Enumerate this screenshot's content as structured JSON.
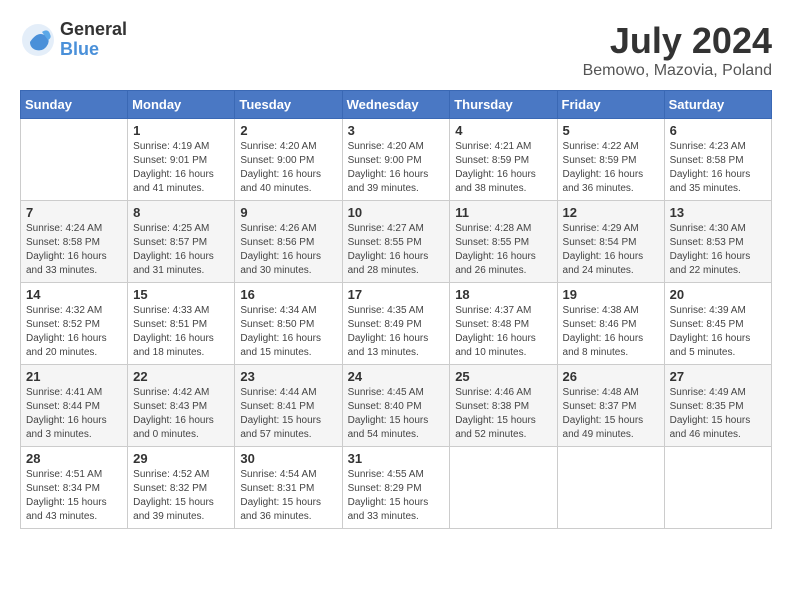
{
  "logo": {
    "general": "General",
    "blue": "Blue"
  },
  "title": {
    "month_year": "July 2024",
    "location": "Bemowo, Mazovia, Poland"
  },
  "days_of_week": [
    "Sunday",
    "Monday",
    "Tuesday",
    "Wednesday",
    "Thursday",
    "Friday",
    "Saturday"
  ],
  "weeks": [
    [
      {
        "day": "",
        "info": ""
      },
      {
        "day": "1",
        "info": "Sunrise: 4:19 AM\nSunset: 9:01 PM\nDaylight: 16 hours\nand 41 minutes."
      },
      {
        "day": "2",
        "info": "Sunrise: 4:20 AM\nSunset: 9:00 PM\nDaylight: 16 hours\nand 40 minutes."
      },
      {
        "day": "3",
        "info": "Sunrise: 4:20 AM\nSunset: 9:00 PM\nDaylight: 16 hours\nand 39 minutes."
      },
      {
        "day": "4",
        "info": "Sunrise: 4:21 AM\nSunset: 8:59 PM\nDaylight: 16 hours\nand 38 minutes."
      },
      {
        "day": "5",
        "info": "Sunrise: 4:22 AM\nSunset: 8:59 PM\nDaylight: 16 hours\nand 36 minutes."
      },
      {
        "day": "6",
        "info": "Sunrise: 4:23 AM\nSunset: 8:58 PM\nDaylight: 16 hours\nand 35 minutes."
      }
    ],
    [
      {
        "day": "7",
        "info": "Sunrise: 4:24 AM\nSunset: 8:58 PM\nDaylight: 16 hours\nand 33 minutes."
      },
      {
        "day": "8",
        "info": "Sunrise: 4:25 AM\nSunset: 8:57 PM\nDaylight: 16 hours\nand 31 minutes."
      },
      {
        "day": "9",
        "info": "Sunrise: 4:26 AM\nSunset: 8:56 PM\nDaylight: 16 hours\nand 30 minutes."
      },
      {
        "day": "10",
        "info": "Sunrise: 4:27 AM\nSunset: 8:55 PM\nDaylight: 16 hours\nand 28 minutes."
      },
      {
        "day": "11",
        "info": "Sunrise: 4:28 AM\nSunset: 8:55 PM\nDaylight: 16 hours\nand 26 minutes."
      },
      {
        "day": "12",
        "info": "Sunrise: 4:29 AM\nSunset: 8:54 PM\nDaylight: 16 hours\nand 24 minutes."
      },
      {
        "day": "13",
        "info": "Sunrise: 4:30 AM\nSunset: 8:53 PM\nDaylight: 16 hours\nand 22 minutes."
      }
    ],
    [
      {
        "day": "14",
        "info": "Sunrise: 4:32 AM\nSunset: 8:52 PM\nDaylight: 16 hours\nand 20 minutes."
      },
      {
        "day": "15",
        "info": "Sunrise: 4:33 AM\nSunset: 8:51 PM\nDaylight: 16 hours\nand 18 minutes."
      },
      {
        "day": "16",
        "info": "Sunrise: 4:34 AM\nSunset: 8:50 PM\nDaylight: 16 hours\nand 15 minutes."
      },
      {
        "day": "17",
        "info": "Sunrise: 4:35 AM\nSunset: 8:49 PM\nDaylight: 16 hours\nand 13 minutes."
      },
      {
        "day": "18",
        "info": "Sunrise: 4:37 AM\nSunset: 8:48 PM\nDaylight: 16 hours\nand 10 minutes."
      },
      {
        "day": "19",
        "info": "Sunrise: 4:38 AM\nSunset: 8:46 PM\nDaylight: 16 hours\nand 8 minutes."
      },
      {
        "day": "20",
        "info": "Sunrise: 4:39 AM\nSunset: 8:45 PM\nDaylight: 16 hours\nand 5 minutes."
      }
    ],
    [
      {
        "day": "21",
        "info": "Sunrise: 4:41 AM\nSunset: 8:44 PM\nDaylight: 16 hours\nand 3 minutes."
      },
      {
        "day": "22",
        "info": "Sunrise: 4:42 AM\nSunset: 8:43 PM\nDaylight: 16 hours\nand 0 minutes."
      },
      {
        "day": "23",
        "info": "Sunrise: 4:44 AM\nSunset: 8:41 PM\nDaylight: 15 hours\nand 57 minutes."
      },
      {
        "day": "24",
        "info": "Sunrise: 4:45 AM\nSunset: 8:40 PM\nDaylight: 15 hours\nand 54 minutes."
      },
      {
        "day": "25",
        "info": "Sunrise: 4:46 AM\nSunset: 8:38 PM\nDaylight: 15 hours\nand 52 minutes."
      },
      {
        "day": "26",
        "info": "Sunrise: 4:48 AM\nSunset: 8:37 PM\nDaylight: 15 hours\nand 49 minutes."
      },
      {
        "day": "27",
        "info": "Sunrise: 4:49 AM\nSunset: 8:35 PM\nDaylight: 15 hours\nand 46 minutes."
      }
    ],
    [
      {
        "day": "28",
        "info": "Sunrise: 4:51 AM\nSunset: 8:34 PM\nDaylight: 15 hours\nand 43 minutes."
      },
      {
        "day": "29",
        "info": "Sunrise: 4:52 AM\nSunset: 8:32 PM\nDaylight: 15 hours\nand 39 minutes."
      },
      {
        "day": "30",
        "info": "Sunrise: 4:54 AM\nSunset: 8:31 PM\nDaylight: 15 hours\nand 36 minutes."
      },
      {
        "day": "31",
        "info": "Sunrise: 4:55 AM\nSunset: 8:29 PM\nDaylight: 15 hours\nand 33 minutes."
      },
      {
        "day": "",
        "info": ""
      },
      {
        "day": "",
        "info": ""
      },
      {
        "day": "",
        "info": ""
      }
    ]
  ]
}
